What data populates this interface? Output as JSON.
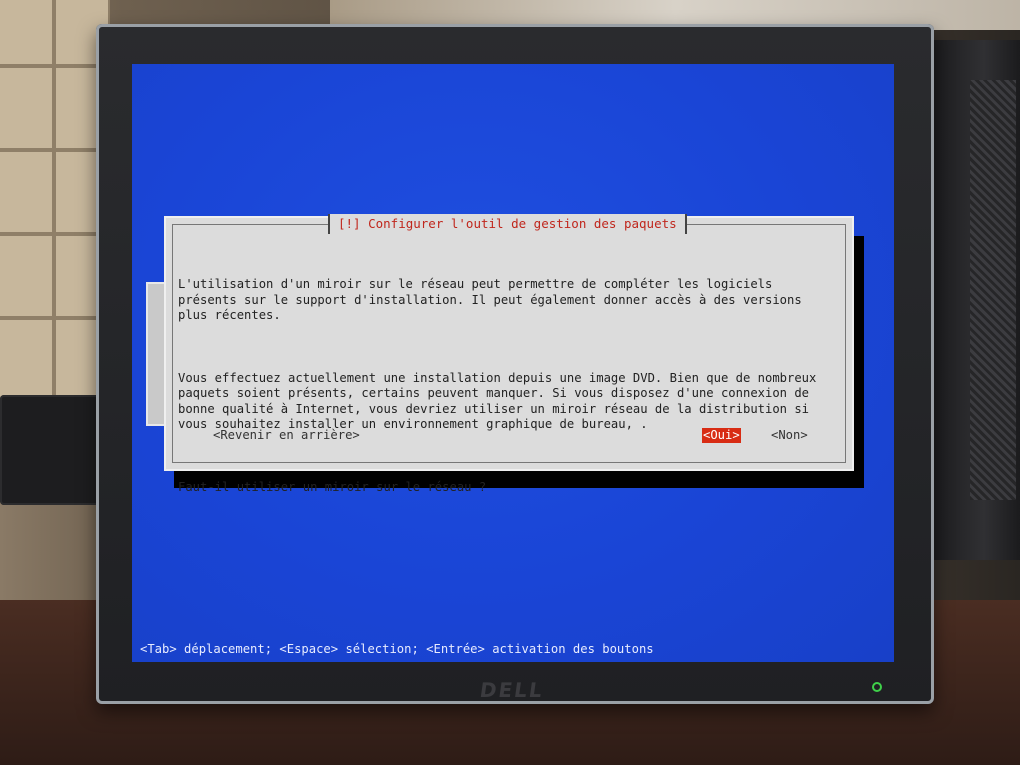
{
  "dialog": {
    "title": "[!] Configurer l'outil de gestion des paquets",
    "paragraph1": "L'utilisation d'un miroir sur le réseau peut permettre de compléter les logiciels\nprésents sur le support d'installation. Il peut également donner accès à des versions\nplus récentes.",
    "paragraph2": "Vous effectuez actuellement une installation depuis une image DVD. Bien que de nombreux\npaquets soient présents, certains peuvent manquer. Si vous disposez d'une connexion de\nbonne qualité à Internet, vous devriez utiliser un miroir réseau de la distribution si\nvous souhaitez installer un environnement graphique de bureau, .",
    "question": "Faut-il utiliser un miroir sur le réseau ?",
    "buttons": {
      "back": "<Revenir en arrière>",
      "yes": "<Oui>",
      "no": "<Non>"
    },
    "selected_button": "yes"
  },
  "help_line": "<Tab> déplacement; <Espace> sélection; <Entrée> activation des boutons",
  "monitor": {
    "brand": "DELL"
  },
  "colors": {
    "screen_background": "#1a45d6",
    "dialog_background": "#dcdcdc",
    "title_text": "#c0261c",
    "selected_button": "#d82c14"
  }
}
